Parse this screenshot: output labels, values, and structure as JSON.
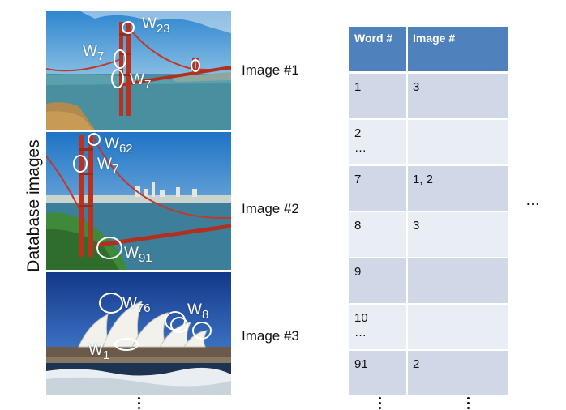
{
  "side_label": "Database images",
  "images": [
    {
      "caption": "Image #1",
      "words": [
        {
          "prefix": "W",
          "sub": "23"
        },
        {
          "prefix": "W",
          "sub": "7"
        },
        {
          "prefix": "W",
          "sub": "7"
        }
      ]
    },
    {
      "caption": "Image #2",
      "words": [
        {
          "prefix": "W",
          "sub": "62"
        },
        {
          "prefix": "W",
          "sub": "7"
        },
        {
          "prefix": "W",
          "sub": "91"
        }
      ]
    },
    {
      "caption": "Image #3",
      "words": [
        {
          "prefix": "W",
          "sub": "76"
        },
        {
          "prefix": "W",
          "sub": "8"
        },
        {
          "prefix": "W",
          "sub": "1"
        }
      ]
    }
  ],
  "table": {
    "headers": [
      "Word #",
      "Image #"
    ],
    "rows": [
      [
        "1",
        "3"
      ],
      [
        "2\n…",
        ""
      ],
      [
        "7",
        "1, 2"
      ],
      [
        "8",
        "3"
      ],
      [
        "9",
        ""
      ],
      [
        "10\n…",
        ""
      ],
      [
        "91",
        "2"
      ]
    ]
  },
  "ellipsis": "…",
  "colors": {
    "header": "#4f81bd",
    "row_dark": "#d0d8e8",
    "row_light": "#e9edf4"
  }
}
